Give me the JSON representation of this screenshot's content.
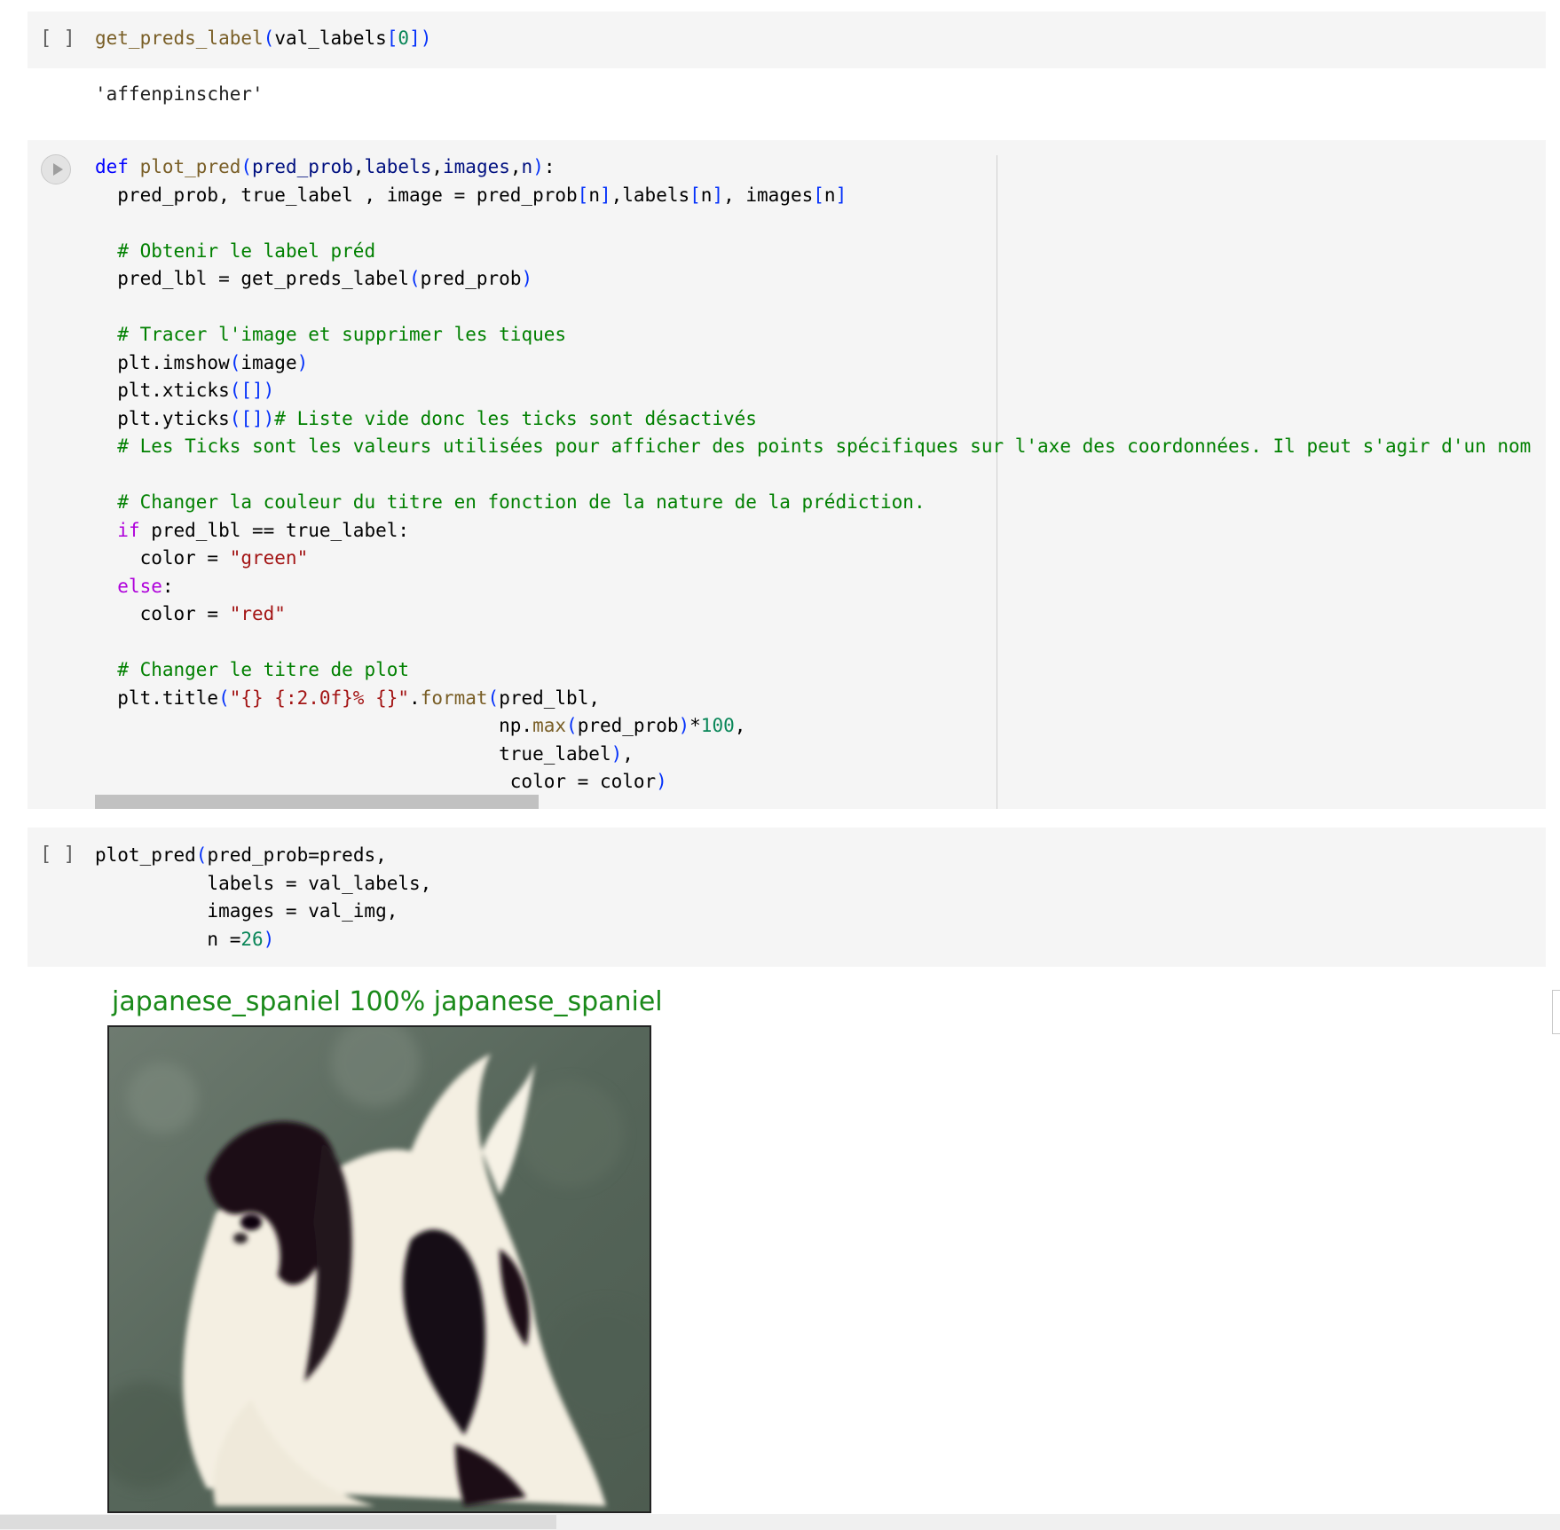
{
  "cells": {
    "cell1": {
      "run_indicator": "[ ]",
      "code_lines": [
        "get_preds_label(val_labels[0])"
      ],
      "output": "'affenpinscher'"
    },
    "cell2": {
      "run_indicator": "[ ]",
      "code_lines": [
        "def plot_pred(pred_prob,labels,images,n):",
        "  pred_prob, true_label , image = pred_prob[n],labels[n], images[n]",
        "",
        "  # Obtenir le label préd",
        "  pred_lbl = get_preds_label(pred_prob)",
        "",
        "  # Tracer l'image et supprimer les tiques",
        "  plt.imshow(image)",
        "  plt.xticks([])",
        "  plt.yticks([])# Liste vide donc les ticks sont désactivés",
        "  # Les Ticks sont les valeurs utilisées pour afficher des points spécifiques sur l'axe des coordonnées. Il peut s'agir d'un nom",
        "",
        "  # Changer la couleur du titre en fonction de la nature de la prédiction.",
        "  if pred_lbl == true_label:",
        "    color = \"green\"",
        "  else:",
        "    color = \"red\"",
        "",
        "  # Changer le titre de plot",
        "  plt.title(\"{} {:2.0f}% {}\".format(pred_lbl,",
        "                                    np.max(pred_prob)*100,",
        "                                    true_label),",
        "                                     color = color)"
      ]
    },
    "cell3": {
      "run_indicator": "[ ]",
      "code_lines": [
        "plot_pred(pred_prob=preds,",
        "          labels = val_labels,",
        "          images = val_img,",
        "          n =26)"
      ]
    }
  },
  "plot": {
    "title": "japanese_spaniel 100% japanese_spaniel",
    "title_color": "#1a8a1a",
    "image_subject": "japanese spaniel dog on grass"
  },
  "icons": {
    "run_button": "play-circle-icon"
  }
}
